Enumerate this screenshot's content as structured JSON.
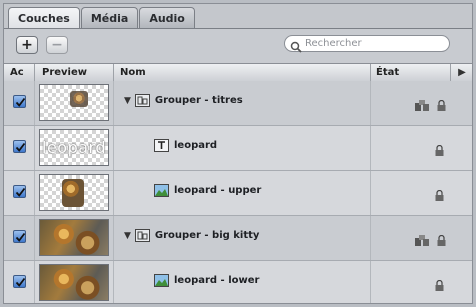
{
  "tabs": [
    {
      "label": "Couches",
      "active": true
    },
    {
      "label": "Média",
      "active": false
    },
    {
      "label": "Audio",
      "active": false
    }
  ],
  "toolbar": {
    "add_label": "+",
    "remove_label": "−",
    "search_placeholder": "Rechercher"
  },
  "columns": {
    "active": "Ac",
    "preview": "Preview",
    "name": "Nom",
    "state": "État"
  },
  "rows": [
    {
      "name": "Grouper - titres",
      "kind": "group",
      "expanded": true,
      "preview": "composite-small",
      "checked": true,
      "state_icons": [
        "group-state-icon",
        "lock-icon"
      ]
    },
    {
      "name": "leopard",
      "kind": "text",
      "preview": "text-leopard",
      "preview_text": "leopard",
      "checked": true,
      "state_icons": [
        "lock-icon"
      ]
    },
    {
      "name": "leopard - upper",
      "kind": "image",
      "preview": "image-small",
      "checked": true,
      "state_icons": [
        "lock-icon"
      ]
    },
    {
      "name": "Grouper - big kitty",
      "kind": "group",
      "expanded": true,
      "preview": "image-full",
      "checked": true,
      "state_icons": [
        "group-state-icon",
        "lock-icon"
      ]
    },
    {
      "name": "leopard - lower",
      "kind": "image",
      "preview": "image-full",
      "checked": true,
      "state_icons": [
        "lock-icon"
      ]
    }
  ],
  "colors": {
    "checkbox": "#3f78cc",
    "panel": "#c4c7cc"
  }
}
